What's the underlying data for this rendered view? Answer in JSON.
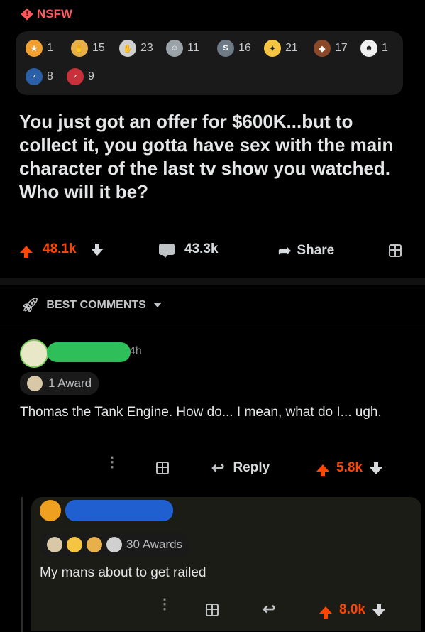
{
  "badge": {
    "label": "NSFW",
    "icon": "warning-diamond-icon",
    "color": "#ff585b"
  },
  "awards": [
    {
      "icon": "award-icon-1",
      "count": "1",
      "color": "#f0a030"
    },
    {
      "icon": "award-icon-2",
      "count": "15",
      "color": "#e8b04a"
    },
    {
      "icon": "award-icon-3",
      "count": "23",
      "color": "#d0d0d0"
    },
    {
      "icon": "award-icon-4",
      "count": "11",
      "color": "#9aa3a8"
    },
    {
      "icon": "award-icon-5",
      "count": "16",
      "color": "#6e7a86"
    },
    {
      "icon": "award-icon-6",
      "count": "21",
      "color": "#f5c542"
    },
    {
      "icon": "award-icon-7",
      "count": "17",
      "color": "#8a4a2a"
    },
    {
      "icon": "award-icon-8",
      "count": "1",
      "color": "#f0f0f0"
    },
    {
      "icon": "voted-icon",
      "count": "8",
      "color": "#2b5fa8"
    },
    {
      "icon": "vote-icon",
      "count": "9",
      "color": "#c8303a"
    }
  ],
  "post": {
    "title": "You just got an offer for $600K...but to collect it, you gotta have sex with the main character of the last tv show you watched. Who will it be?",
    "upvotes": "48.1k",
    "comments": "43.3k",
    "share_label": "Share"
  },
  "sort": {
    "label": "BEST COMMENTS"
  },
  "comments": [
    {
      "time": "4h",
      "awards_label": "1 Award",
      "text": "Thomas the Tank Engine. How do... I mean, what do I... ugh.",
      "reply_label": "Reply",
      "score": "5.8k",
      "redact_color": "#2fbf5a"
    },
    {
      "awards_label": "30 Awards",
      "text": "My mans about to get railed",
      "score": "8.0k",
      "redact_color": "#1f5fd0"
    }
  ],
  "colors": {
    "accent": "#ff4500",
    "background": "#000000",
    "card": "#1a1a1b"
  }
}
